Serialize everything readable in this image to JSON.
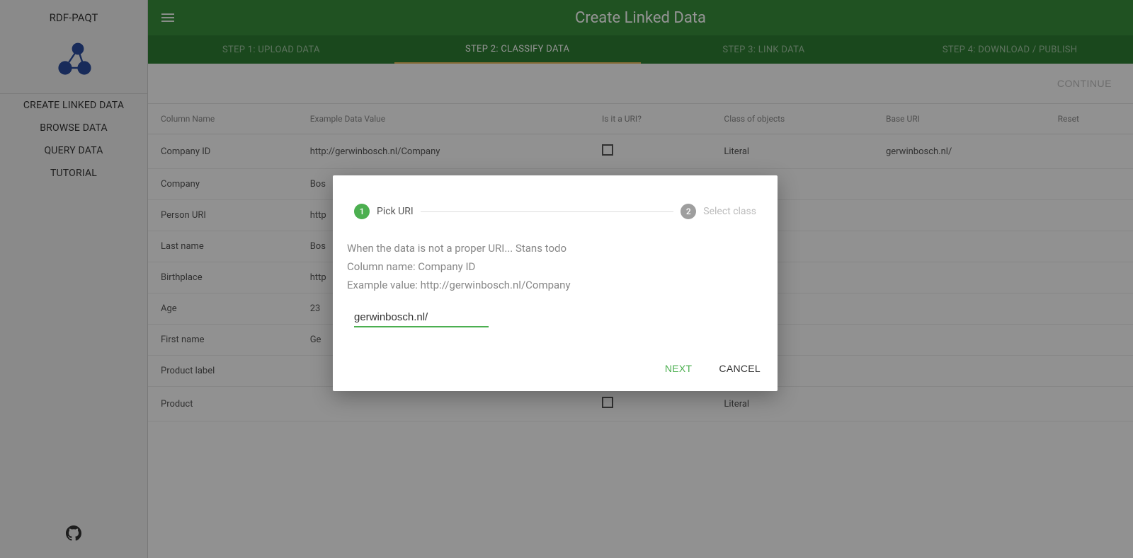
{
  "sidebar": {
    "title": "RDF-PAQT",
    "items": [
      "CREATE LINKED DATA",
      "BROWSE DATA",
      "QUERY DATA",
      "TUTORIAL"
    ]
  },
  "appbar": {
    "title": "Create Linked Data"
  },
  "steps": [
    "STEP 1: UPLOAD DATA",
    "STEP 2: CLASSIFY DATA",
    "STEP 3: LINK DATA",
    "STEP 4: DOWNLOAD / PUBLISH"
  ],
  "active_step_index": 1,
  "continue_label": "CONTINUE",
  "table": {
    "headers": [
      "Column Name",
      "Example Data Value",
      "Is it a URI?",
      "Class of objects",
      "Base URI",
      "Reset"
    ],
    "rows": [
      {
        "col": "Company ID",
        "example": "http://gerwinbosch.nl/Company",
        "checkbox": true,
        "class_": "Literal",
        "base": "gerwinbosch.nl/"
      },
      {
        "col": "Company",
        "example": "Bos",
        "checkbox": false,
        "class_": "",
        "base": ""
      },
      {
        "col": "Person URI",
        "example": "http",
        "checkbox": false,
        "class_": "",
        "base": ""
      },
      {
        "col": "Last name",
        "example": "Bos",
        "checkbox": false,
        "class_": "",
        "base": ""
      },
      {
        "col": "Birthplace",
        "example": "http",
        "checkbox": false,
        "class_": "",
        "base": ""
      },
      {
        "col": "Age",
        "example": "23",
        "checkbox": false,
        "class_": "",
        "base": ""
      },
      {
        "col": "First name",
        "example": "Ge",
        "checkbox": false,
        "class_": "",
        "base": ""
      },
      {
        "col": "Product label",
        "example": "",
        "checkbox": false,
        "class_": "",
        "base": ""
      },
      {
        "col": "Product",
        "example": "",
        "checkbox": true,
        "class_": "Literal",
        "base": ""
      }
    ]
  },
  "dialog": {
    "step1_num": "1",
    "step1_label": "Pick URI",
    "step2_num": "2",
    "step2_label": "Select class",
    "help_text": "When the data is not a proper URI... Stans todo",
    "column_line": "Column name: Company ID",
    "example_line": "Example value: http://gerwinbosch.nl/Company",
    "input_value": "gerwinbosch.nl/",
    "next_label": "NEXT",
    "cancel_label": "CANCEL"
  }
}
